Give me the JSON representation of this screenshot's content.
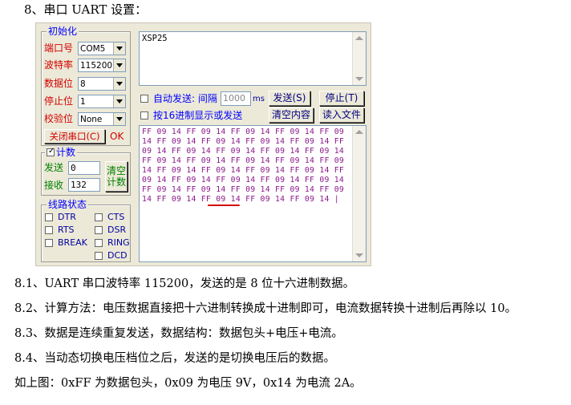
{
  "heading": "8、串口 UART 设置：",
  "app": {
    "init": {
      "legend": "初始化",
      "port_label": "端口号",
      "port_value": "COM5",
      "baud_label": "波特率",
      "baud_value": "115200",
      "data_label": "数据位",
      "data_value": "8",
      "stop_label": "停止位",
      "stop_value": "1",
      "parity_label": "校验位",
      "parity_value": "None",
      "close_button": "关闭串口(C)",
      "status": "OK"
    },
    "count": {
      "legend": "计数",
      "send_label": "发送",
      "send_value": "0",
      "recv_label": "接收",
      "recv_value": "132",
      "clear_button_l1": "清空",
      "clear_button_l2": "计数"
    },
    "lines": {
      "legend": "线路状态",
      "dtr": "DTR",
      "cts": "CTS",
      "rts": "RTS",
      "dsr": "DSR",
      "break": "BREAK",
      "ring": "RING",
      "dcd": "DCD"
    },
    "send_text": "XSP25",
    "auto_send_label": "自动发送: 间隔",
    "interval_value": "1000",
    "interval_unit": "ms",
    "send_button": "发送(S)",
    "stop_button": "停止(T)",
    "hex_label": "按16进制显示或发送",
    "clear_content_button": "清空内容",
    "read_file_button": "读入文件",
    "receive_lines": [
      "FF 09 14 FF 09 14 FF 09 14 FF 09 14 FF 09",
      "14 FF 09 14 FF 09 14 FF 09 14 FF 09 14 FF",
      "09 14 FF 09 14 FF 09 14 FF 09 14 FF 09 14",
      "FF 09 14 FF 09 14 FF 09 14 FF 09 14 FF 09",
      "14 FF 09 14 FF 09 14 FF 09 14 FF 09 14 FF",
      "09 14 FF 09 14 FF 09 14 FF 09 14 FF 09 14",
      "FF 09 14 FF 09 14 FF 09 14 FF 09 14 FF 09",
      "14 FF 09 14 FF 09 14 FF 09 14 FF 09 14 |"
    ]
  },
  "paragraphs": [
    "8.1、UART 串口波特率 115200，发送的是 8 位十六进制数据。",
    "8.2、计算方法：电压数据直接把十六进制转换成十进制即可，电流数据转换十进制后再除以 10。",
    "8.3、数据是连续重复发送，数据结构：数据包头+电压+电流。",
    "8.4、当动态切换电压档位之后，发送的是切换电压后的数据。",
    "如上图：0xFF 为数据包头，0x09 为电压 9V，0x14 为电流 2A。"
  ]
}
